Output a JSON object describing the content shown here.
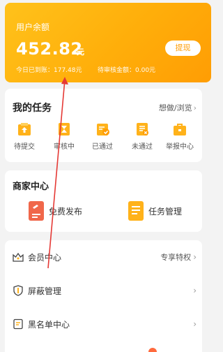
{
  "balance": {
    "title": "用户余额",
    "amount": "452.82",
    "unit": "元",
    "withdraw_label": "提现",
    "today_arrived": "今日已到账：177.48元",
    "pending": "待审核金额：0.00元"
  },
  "tasks": {
    "title": "我的任务",
    "link_label": "想做/浏览",
    "items": [
      {
        "label": "待提交"
      },
      {
        "label": "审核中"
      },
      {
        "label": "已通过"
      },
      {
        "label": "未通过"
      },
      {
        "label": "举报中心"
      }
    ]
  },
  "merchant": {
    "title": "商家中心",
    "publish_label": "免费发布",
    "manage_label": "任务管理"
  },
  "menu": {
    "vip_label": "会员中心",
    "vip_right": "专享特权",
    "block_label": "屏蔽管理",
    "blacklist_label": "黑名单中心"
  },
  "colors": {
    "accent": "#ffae0a",
    "annotation": "#e53935"
  }
}
